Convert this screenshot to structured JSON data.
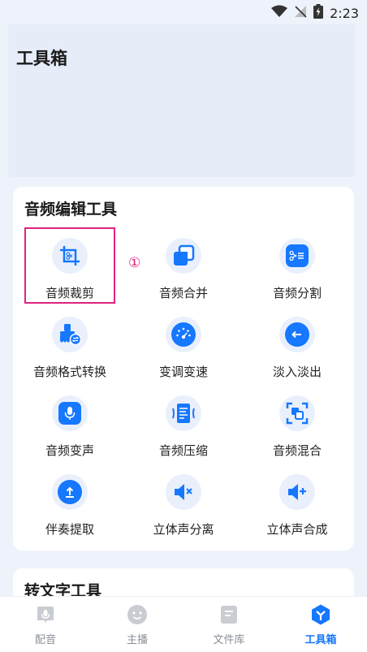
{
  "status_bar": {
    "time": "2:23"
  },
  "page": {
    "title": "工具箱"
  },
  "audio_section": {
    "title": "音频编辑工具",
    "tools": [
      {
        "label": "音频裁剪",
        "icon": "crop-icon"
      },
      {
        "label": "音频合并",
        "icon": "merge-icon"
      },
      {
        "label": "音频分割",
        "icon": "split-icon"
      },
      {
        "label": "音频格式转换",
        "icon": "format-convert-icon"
      },
      {
        "label": "变调变速",
        "icon": "speed-dial-icon"
      },
      {
        "label": "淡入淡出",
        "icon": "fade-icon"
      },
      {
        "label": "音频变声",
        "icon": "microphone-icon"
      },
      {
        "label": "音频压缩",
        "icon": "compress-icon"
      },
      {
        "label": "音频混合",
        "icon": "mix-icon"
      },
      {
        "label": "伴奏提取",
        "icon": "extract-icon"
      },
      {
        "label": "立体声分离",
        "icon": "stereo-split-icon"
      },
      {
        "label": "立体声合成",
        "icon": "stereo-merge-icon"
      }
    ],
    "annotation_marker": "①"
  },
  "text_section": {
    "title": "转文字工具"
  },
  "tabs": [
    {
      "label": "配音",
      "icon": "dubbing-icon",
      "active": false
    },
    {
      "label": "主播",
      "icon": "anchor-face-icon",
      "active": false
    },
    {
      "label": "文件库",
      "icon": "file-library-icon",
      "active": false
    },
    {
      "label": "工具箱",
      "icon": "toolbox-icon",
      "active": true
    }
  ],
  "colors": {
    "accent": "#1677ff",
    "highlight": "#e0217f",
    "background": "#eef3fb"
  }
}
